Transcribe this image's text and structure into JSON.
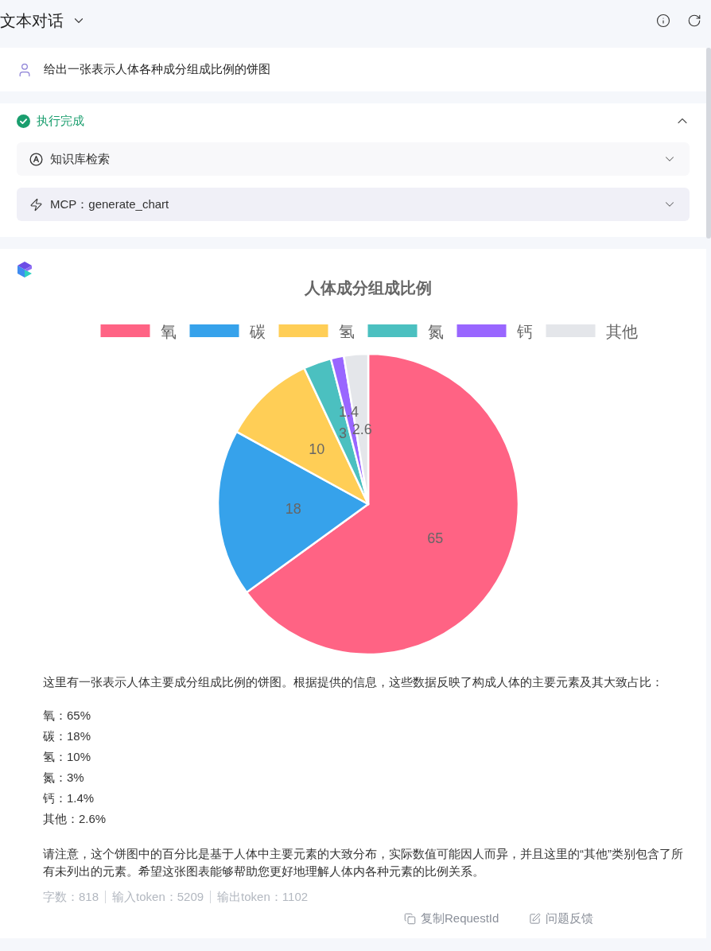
{
  "header": {
    "title": "文本对话"
  },
  "question": {
    "text": "给出一张表示人体各种成分组成比例的饼图"
  },
  "execution": {
    "status": "执行完成",
    "expanded": true,
    "steps": [
      {
        "kind": "knowledge",
        "label": "知识库检索",
        "expanded": false
      },
      {
        "kind": "tool",
        "label": "MCP：generate_chart",
        "expanded": false
      }
    ]
  },
  "answer": {
    "chart_data": {
      "type": "pie",
      "title": "人体成分组成比例",
      "legend": "top",
      "categories": [
        "氧",
        "碳",
        "氢",
        "氮",
        "钙",
        "其他"
      ],
      "series": [
        {
          "values": [
            65,
            18,
            10,
            3,
            1.4,
            2.6
          ]
        }
      ],
      "colors": [
        "#ff6384",
        "#36a2eb",
        "#ffce56",
        "#4bc0c0",
        "#9966ff",
        "#e4e6ea"
      ],
      "data_labels": true
    },
    "intro": "这里有一张表示人体主要成分组成比例的饼图。根据提供的信息，这些数据反映了构成人体的主要元素及其大致占比：",
    "items": [
      "氧：65%",
      "碳：18%",
      "氢：10%",
      "氮：3%",
      "钙：1.4%",
      "其他：2.6%"
    ],
    "note": "请注意，这个饼图中的百分比是基于人体中主要元素的大致分布，实际数值可能因人而异，并且这里的“其他”类别包含了所有未列出的元素。希望这张图表能够帮助您更好地理解人体内各种元素的比例关系。",
    "stats": [
      "字数：818",
      "输入token：5209",
      "输出token：1102"
    ],
    "actions": [
      {
        "kind": "copy",
        "label": "复制RequestId"
      },
      {
        "kind": "feedback",
        "label": "问题反馈"
      }
    ]
  }
}
